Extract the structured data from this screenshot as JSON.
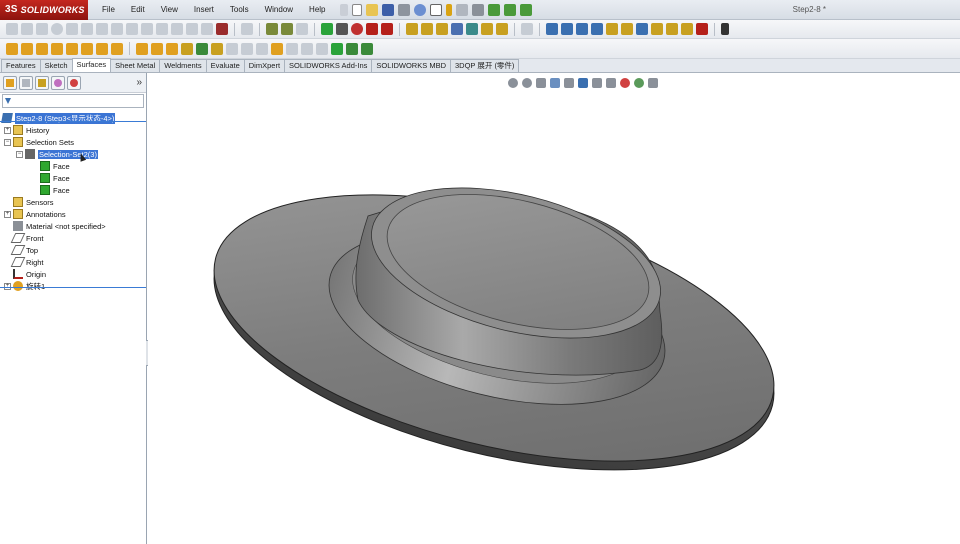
{
  "app": {
    "brand": "SOLIDWORKS",
    "brand_mark": "3S",
    "doc_title": "Step2-8 *"
  },
  "menu": [
    "File",
    "Edit",
    "View",
    "Insert",
    "Tools",
    "Window",
    "Help"
  ],
  "cm_tabs": [
    "Features",
    "Sketch",
    "Surfaces",
    "Sheet Metal",
    "Weldments",
    "Evaluate",
    "DimXpert",
    "SOLIDWORKS Add-Ins",
    "SOLIDWORKS MBD",
    "3DQP 展开 (零件)"
  ],
  "cm_active": "Surfaces",
  "fm": {
    "expand_glyph": "»",
    "filter_icon": "filter-icon",
    "root": "Step2-8  (Step3<显示状态-4>)",
    "items": {
      "history": "History",
      "selection_sets": "Selection Sets",
      "selection_set": "Selection-Set2(3)",
      "face1": "Face",
      "face2": "Face",
      "face3": "Face",
      "sensors": "Sensors",
      "annotations": "Annotations",
      "material": "Material <not specified>",
      "front": "Front",
      "top": "Top",
      "right": "Right",
      "origin": "Origin",
      "feature": "旋转1"
    }
  },
  "colors": {
    "brand_red": "#b5201a",
    "selection_blue": "#3b74d4",
    "model_gray": "#7a7a7a",
    "face_green": "#2fa82f"
  }
}
